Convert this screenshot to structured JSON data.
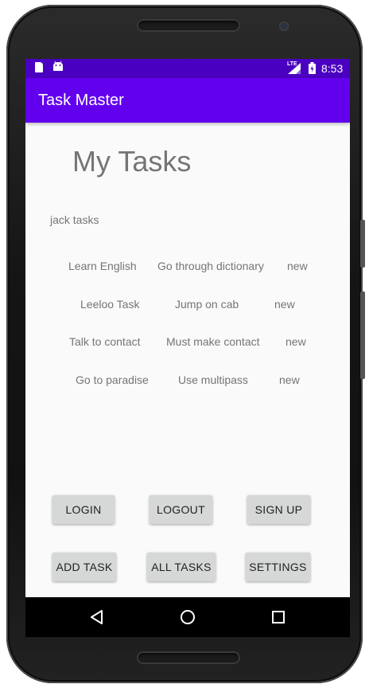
{
  "status_bar": {
    "time": "8:53",
    "network": "LTE",
    "icons": [
      "sd-card-icon",
      "android-icon",
      "signal-icon",
      "battery-icon"
    ]
  },
  "app_bar": {
    "title": "Task Master",
    "color": "#6200ee",
    "status_color": "#4a00c0"
  },
  "main": {
    "title": "My Tasks",
    "user_label": "jack tasks",
    "tasks": [
      {
        "title": "Learn English",
        "body": "Go through dictionary",
        "state": "new"
      },
      {
        "title": "Leeloo Task",
        "body": "Jump on cab",
        "state": "new"
      },
      {
        "title": "Talk to contact",
        "body": "Must make contact",
        "state": "new"
      },
      {
        "title": "Go to paradise",
        "body": "Use multipass",
        "state": "new"
      }
    ]
  },
  "buttons": {
    "login": "LOGIN",
    "logout": "LOGOUT",
    "sign_up": "SIGN UP",
    "add_task": "ADD TASK",
    "all_tasks": "ALL TASKS",
    "settings": "SETTINGS"
  },
  "nav_bar": {
    "icons": [
      "back-icon",
      "home-icon",
      "recents-icon"
    ]
  }
}
